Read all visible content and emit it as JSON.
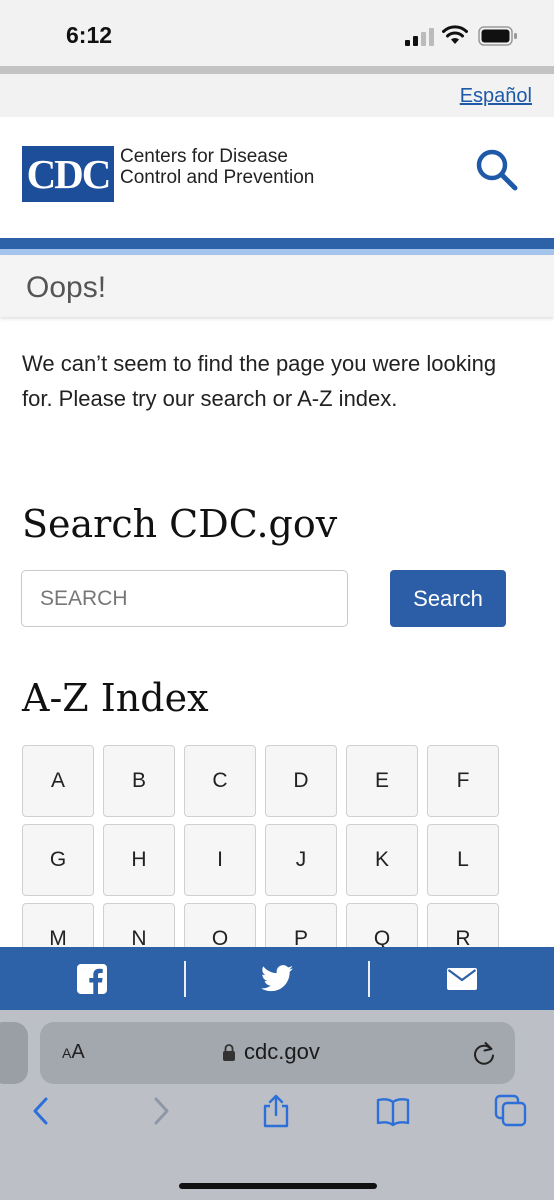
{
  "status_bar": {
    "time": "6:12"
  },
  "language_link": "Español",
  "header": {
    "logo_text": "CDC",
    "org_line1": "Centers for Disease",
    "org_line2": "Control and Prevention",
    "search_icon": "search-icon"
  },
  "oops_title": "Oops!",
  "message": "We can’t seem to find the page you were looking for. Please try our search or A-Z index.",
  "search": {
    "heading": "Search CDC.gov",
    "placeholder": "SEARCH",
    "button_label": "Search"
  },
  "az": {
    "heading": "A-Z Index",
    "letters": [
      "A",
      "B",
      "C",
      "D",
      "E",
      "F",
      "G",
      "H",
      "I",
      "J",
      "K",
      "L",
      "M",
      "N",
      "O",
      "P",
      "Q",
      "R"
    ]
  },
  "share": [
    "facebook-icon",
    "twitter-icon",
    "email-icon"
  ],
  "browser": {
    "aa_label": "AA",
    "url": "cdc.gov"
  },
  "colors": {
    "brand_blue": "#2d61a8",
    "link_blue": "#1e5aa8",
    "light_blue": "#a5c4ec"
  }
}
